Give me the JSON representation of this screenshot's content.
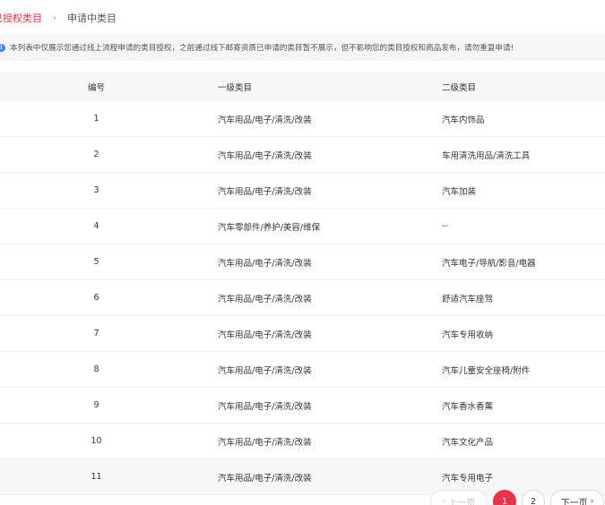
{
  "tabs": {
    "authorized": "已授权类目",
    "separator": "›",
    "applying": "申请中类目"
  },
  "notice": {
    "icon": "info-icon",
    "text": "本列表中仅展示您通过线上流程申请的类目授权，之前通过线下邮寄资质已申请的类目暂不展示，但不影响您的类目授权和商品发布，请勿重复申请!"
  },
  "table": {
    "headers": {
      "no": "编号",
      "level1": "一级类目",
      "level2": "二级类目"
    },
    "rows": [
      {
        "no": "1",
        "level1": "汽车用品/电子/清洗/改装",
        "level2": "汽车内饰品"
      },
      {
        "no": "2",
        "level1": "汽车用品/电子/清洗/改装",
        "level2": "车用清洗用品/清洗工具"
      },
      {
        "no": "3",
        "level1": "汽车用品/电子/清洗/改装",
        "level2": "汽车加装"
      },
      {
        "no": "4",
        "level1": "汽车零部件/养护/美容/维保",
        "level2": "--"
      },
      {
        "no": "5",
        "level1": "汽车用品/电子/清洗/改装",
        "level2": "汽车电子/导航/影音/电器"
      },
      {
        "no": "6",
        "level1": "汽车用品/电子/清洗/改装",
        "level2": "舒适汽车座驾"
      },
      {
        "no": "7",
        "level1": "汽车用品/电子/清洗/改装",
        "level2": "汽车专用收纳"
      },
      {
        "no": "8",
        "level1": "汽车用品/电子/清洗/改装",
        "level2": "汽车儿童安全座椅/附件"
      },
      {
        "no": "9",
        "level1": "汽车用品/电子/清洗/改装",
        "level2": "汽车香水香薰"
      },
      {
        "no": "10",
        "level1": "汽车用品/电子/清洗/改装",
        "level2": "汽车文化产品"
      },
      {
        "no": "11",
        "level1": "汽车用品/电子/清洗/改装",
        "level2": "汽车专用电子"
      }
    ]
  },
  "pagination": {
    "prev": "上一页",
    "pages": [
      "1",
      "2"
    ],
    "current": "1",
    "next": "下一页",
    "prev_icon": "chevron-left-icon",
    "next_icon": "chevron-right-icon"
  },
  "colors": {
    "accent": "#e8334a",
    "info": "#3b82f6",
    "notice_bg": "#f3f5f9",
    "header_bg": "#f6f7f9"
  }
}
